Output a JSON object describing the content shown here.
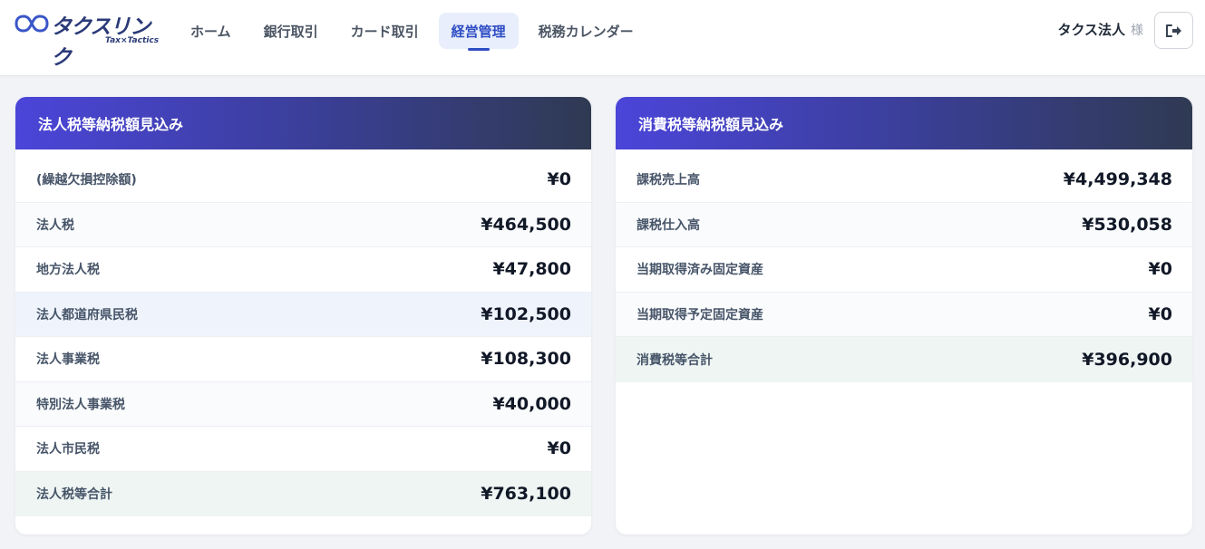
{
  "app": {
    "logo_text": "タクスリンク",
    "logo_sub": "Tax×Tactics"
  },
  "nav": {
    "items": [
      {
        "label": "ホーム"
      },
      {
        "label": "銀行取引"
      },
      {
        "label": "カード取引"
      },
      {
        "label": "経営管理",
        "active": true
      },
      {
        "label": "税務カレンダー"
      }
    ]
  },
  "user": {
    "name": "タクス法人",
    "suffix": "様"
  },
  "corporate_tax": {
    "title": "法人税等納税額見込み",
    "rows": [
      {
        "label": "(繰越欠損控除額)",
        "value": "¥0"
      },
      {
        "label": "法人税",
        "value": "¥464,500"
      },
      {
        "label": "地方法人税",
        "value": "¥47,800"
      },
      {
        "label": "法人都道府県民税",
        "value": "¥102,500"
      },
      {
        "label": "法人事業税",
        "value": "¥108,300"
      },
      {
        "label": "特別法人事業税",
        "value": "¥40,000"
      },
      {
        "label": "法人市民税",
        "value": "¥0"
      },
      {
        "label": "法人税等合計",
        "value": "¥763,100"
      }
    ]
  },
  "consumption_tax": {
    "title": "消費税等納税額見込み",
    "rows": [
      {
        "label": "課税売上高",
        "value": "¥4,499,348"
      },
      {
        "label": "課税仕入高",
        "value": "¥530,058"
      },
      {
        "label": "当期取得済み固定資産",
        "value": "¥0"
      },
      {
        "label": "当期取得予定固定資産",
        "value": "¥0"
      },
      {
        "label": "消費税等合計",
        "value": "¥396,900"
      }
    ]
  },
  "colors": {
    "accent": "#2e4cc4",
    "header_gradient_start": "#4b45d9",
    "header_gradient_end": "#2f3a52"
  }
}
